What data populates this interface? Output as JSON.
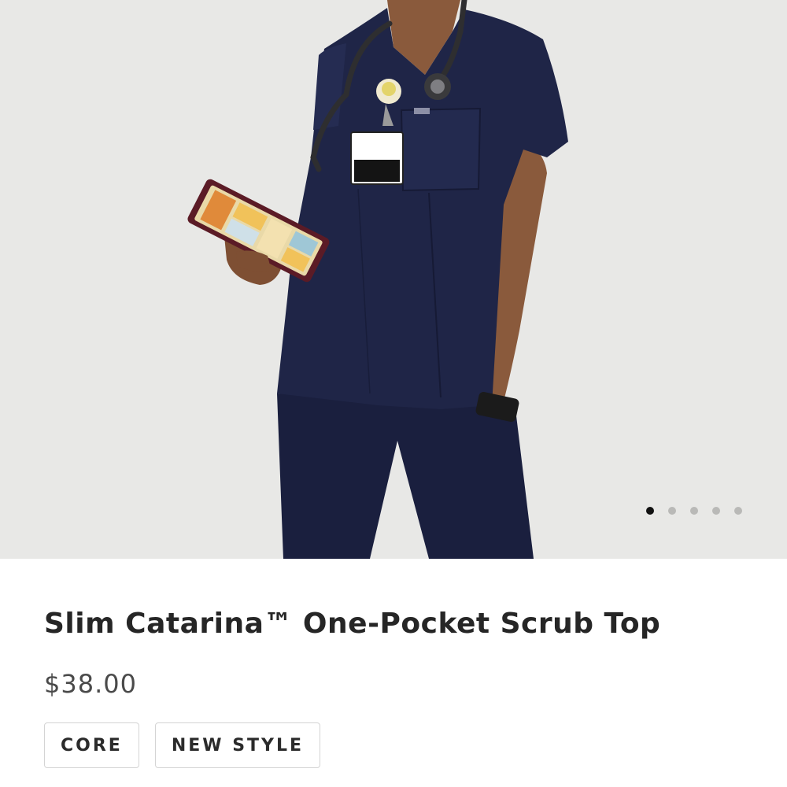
{
  "product": {
    "image_alt": "Model wearing navy slim one-pocket scrub top holding a tablet",
    "carousel_dots": 5,
    "active_dot": 0,
    "title": "Slim Catarina™ One-Pocket Scrub Top",
    "price": "$38.00",
    "tags": [
      "CORE",
      "NEW STYLE"
    ]
  },
  "colors": {
    "background": "#e8e8e6",
    "scrubs": "#1f2547",
    "skin": "#8a5a3c"
  }
}
